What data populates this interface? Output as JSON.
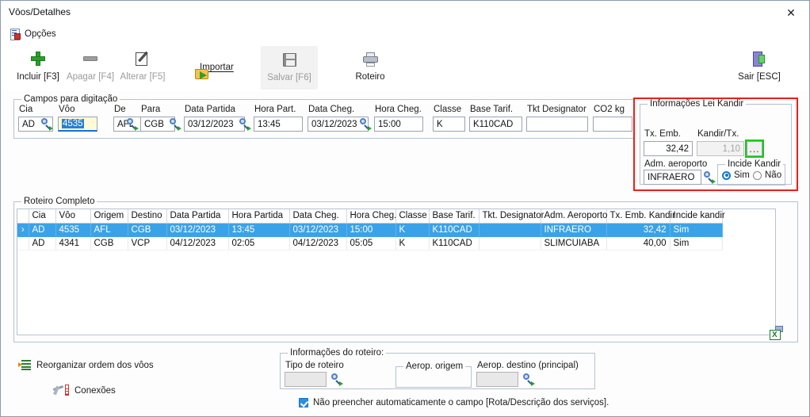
{
  "window": {
    "title": "Vôos/Detalhes",
    "close_icon": "close-icon"
  },
  "menu": {
    "options_label": "Opções"
  },
  "toolbar": {
    "include_label": "Incluir [F3]",
    "delete_label": "Apagar [F4]",
    "change_label": "Alterar [F5]",
    "import_label": "Importar",
    "save_label": "Salvar [F6]",
    "route_label": "Roteiro",
    "exit_label": "Sair [ESC]"
  },
  "entry_group": {
    "legend": "Campos para digitação",
    "fields": [
      {
        "label": "Cia",
        "value": "AD"
      },
      {
        "label": "Vôo",
        "value": "4535"
      },
      {
        "label": "De",
        "value": "AFL"
      },
      {
        "label": "Para",
        "value": "CGB"
      },
      {
        "label": "Data Partida",
        "value": "03/12/2023"
      },
      {
        "label": "Hora Part.",
        "value": "13:45"
      },
      {
        "label": "Data Cheg.",
        "value": "03/12/2023"
      },
      {
        "label": "Hora Cheg.",
        "value": "15:00"
      },
      {
        "label": "Classe",
        "value": "K"
      },
      {
        "label": "Base Tarif.",
        "value": "K110CAD"
      },
      {
        "label": "Tkt Designator",
        "value": ""
      },
      {
        "label": "CO2 kg",
        "value": ""
      }
    ]
  },
  "kandir": {
    "legend": "Informações Lei Kandir",
    "tx_emb_label": "Tx. Emb.",
    "tx_emb_value": "32,42",
    "kandir_tx_label": "Kandir/Tx.",
    "kandir_tx_value": "1,10",
    "ellipsis_button": "...",
    "adm_label": "Adm. aeroporto",
    "adm_value": "INFRAERO",
    "incide_legend": "Incide Kandir",
    "incide_yes": "Sim",
    "incide_no": "Não",
    "incide_selected": "Sim",
    "highlight_red": "#ef1d1d",
    "highlight_green": "#19c719"
  },
  "roteiro_grid": {
    "legend": "Roteiro Completo",
    "columns": [
      "Cia",
      "Vôo",
      "Origem",
      "Destino",
      "Data Partida",
      "Hora Partida",
      "Data Cheg.",
      "Hora Cheg.",
      "Classe",
      "Base Tarif.",
      "Tkt. Designator",
      "Adm. Aeroporto",
      "Tx. Emb. Kandir",
      "Incide kandir"
    ],
    "rows": [
      {
        "marker": "›",
        "selected": true,
        "cells": [
          "AD",
          "4535",
          "AFL",
          "CGB",
          "03/12/2023",
          "13:45",
          "03/12/2023",
          "15:00",
          "K",
          "K110CAD",
          "",
          "INFRAERO",
          "32,42",
          "Sim"
        ]
      },
      {
        "marker": "",
        "selected": false,
        "cells": [
          "AD",
          "4341",
          "CGB",
          "VCP",
          "04/12/2023",
          "02:05",
          "04/12/2023",
          "05:05",
          "K",
          "K110CAD",
          "",
          "SLIMCUIABA",
          "40,00",
          "Sim"
        ]
      }
    ],
    "export_icon": "excel-export-icon",
    "export_icon_letter": "X"
  },
  "footer": {
    "reorder_label": "Reorganizar ordem dos vôos",
    "connections_label": "Conexões",
    "roteiro_legend": "Informações do roteiro:",
    "tipo_label": "Tipo de roteiro",
    "tipo_value": "",
    "origem_label": "Aerop. origem",
    "origem_value": "",
    "destino_label": "Aerop. destino (principal)",
    "destino_value": "",
    "checkbox_label": "Não preencher automaticamente o campo [Rota/Descrição dos serviços].",
    "checkbox_checked": true
  }
}
